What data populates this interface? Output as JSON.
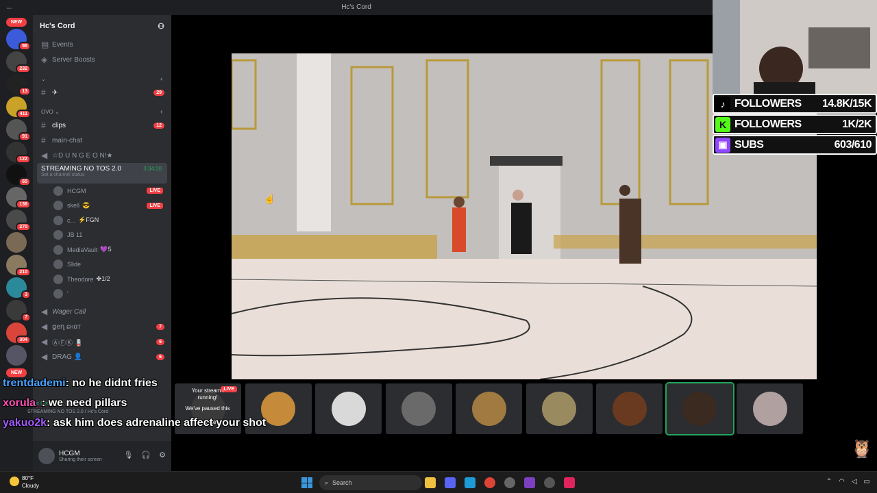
{
  "window": {
    "title": "Hc's Cord"
  },
  "server": {
    "name": "Hc's Cord",
    "new_top": "NEW",
    "new_bottom": "NEW",
    "rail": [
      {
        "badge": "98",
        "color": "#3b5bdb"
      },
      {
        "badge": "232",
        "color": "#444"
      },
      {
        "badge": "13",
        "color": "#222"
      },
      {
        "badge": "411",
        "color": "#c9a227"
      },
      {
        "badge": "91",
        "color": "#555"
      },
      {
        "badge": "122",
        "color": "#333"
      },
      {
        "badge": "65",
        "color": "#111"
      },
      {
        "badge": "136",
        "color": "#666"
      },
      {
        "badge": "270",
        "color": "#4a4a4a"
      },
      {
        "badge": "",
        "color": "#7a6a55"
      },
      {
        "badge": "210",
        "color": "#8a7a60"
      },
      {
        "badge": "3",
        "color": "#2b8a9a"
      },
      {
        "badge": "7",
        "color": "#3a3a3a"
      },
      {
        "badge": "304",
        "color": "#d9453a"
      },
      {
        "badge": "",
        "color": "#556"
      }
    ]
  },
  "channels": {
    "events": "Events",
    "server_boosts": "Server Boosts",
    "cat1_label": "⌄",
    "star_channel": "✈",
    "star_count": "29",
    "cat2_label": "OVO ⌄",
    "clips": "clips",
    "clips_count": "12",
    "main_chat": "main-chat",
    "dungeon": "☆D U N G E O N!★",
    "voice": {
      "name": "STREAMING NO TOS 2.0",
      "timer": "3:34:20",
      "status": "Set a channel status"
    },
    "members": [
      {
        "name": "HCGM",
        "extra": "",
        "live": "LIVE"
      },
      {
        "name": "skell",
        "extra": "😎",
        "live": "LIVE"
      },
      {
        "name": "c...",
        "extra": "⚡FGN",
        "live": ""
      },
      {
        "name": "JB 11",
        "extra": "",
        "live": ""
      },
      {
        "name": "MediaVault",
        "extra": "💜5",
        "live": ""
      },
      {
        "name": "Slide",
        "extra": "",
        "live": ""
      },
      {
        "name": "Theodore",
        "extra": "✤1/2",
        "live": ""
      },
      {
        "name": "'",
        "extra": "",
        "live": ""
      }
    ],
    "wager": "Wager Call",
    "gen_chat": "ցеղ ɕнαт",
    "gen_count": "7",
    "afk": "Ⓐ︎Ⓕ︎Ⓚ︎ 🪫",
    "afk_count": "6",
    "drag": "DRAG 👤",
    "drag_count": "6"
  },
  "user": {
    "name": "HCGM",
    "status": "Sharing their screen",
    "voice_connected": "Voice Connected",
    "voice_sub": "STREAMING NO TOS 2.0 / Hc's Cord"
  },
  "toast": {
    "line1": "Your stream i",
    "line2": "running!",
    "line3": "We've paused this",
    "line4": "resources."
  },
  "chat": [
    {
      "user": "trentdademi",
      "msg": ": no he didnt fries",
      "cls": "u1"
    },
    {
      "user": "xorula_",
      "msg": ": we need pillars",
      "cls": "u2"
    },
    {
      "user": "yakuo2k",
      "msg": ": ask him does adrenaline affect your shot",
      "cls": "u3"
    }
  ],
  "stats": [
    {
      "label": "FOLLOWERS",
      "value": "14.8K/15K",
      "icon": "♪",
      "color": "#ffffff",
      "bg": "#000000"
    },
    {
      "label": "FOLLOWERS",
      "value": "1K/2K",
      "icon": "K",
      "color": "#111111",
      "bg": "#53fc18"
    },
    {
      "label": "SUBS",
      "value": "603/610",
      "icon": "▣",
      "color": "#ffffff",
      "bg": "#9146ff"
    }
  ],
  "tiles": [
    {
      "live": "LIVE",
      "color": "#3a3a3a"
    },
    {
      "live": "",
      "color": "#c58a3a"
    },
    {
      "live": "",
      "color": "#d9d9d9"
    },
    {
      "live": "",
      "color": "#6a6a6a"
    },
    {
      "live": "",
      "color": "#a07a40"
    },
    {
      "live": "",
      "color": "#9a8a60"
    },
    {
      "live": "",
      "color": "#6a3a20"
    },
    {
      "live": "",
      "color": "#3a2a20"
    },
    {
      "live": "",
      "color": "#b0a0a0"
    }
  ],
  "taskbar": {
    "temp": "80°F",
    "weather": "Cloudy",
    "search": "Search"
  }
}
